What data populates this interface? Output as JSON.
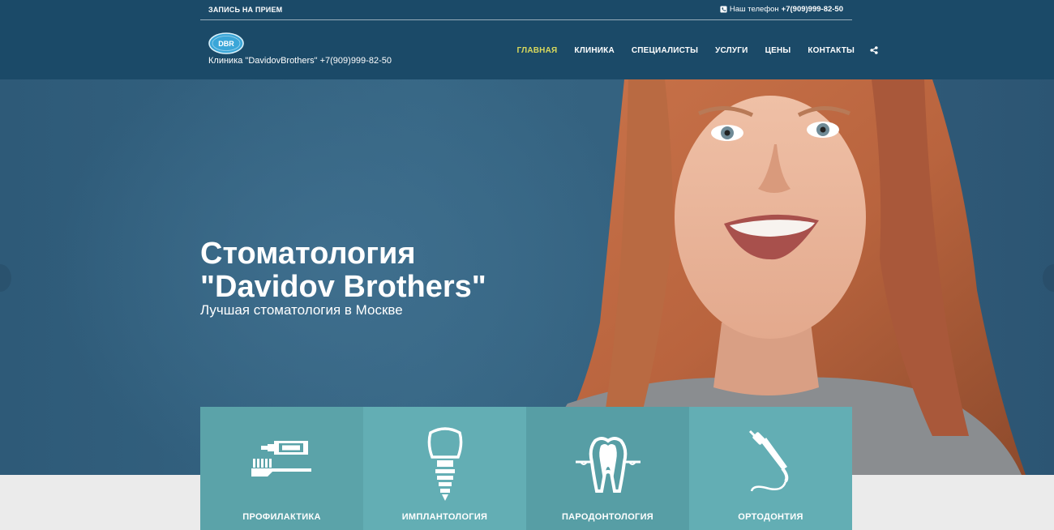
{
  "topbar": {
    "appointment_label": "ЗАПИСЬ НА ПРИЕМ",
    "phone_label": "Наш телефон",
    "phone_number": "+7(909)999-82-50"
  },
  "brand": {
    "logo_text": "DBR",
    "caption": "Клиника \"DavidovBrothers\" +7(909)999-82-50"
  },
  "nav": {
    "items": [
      {
        "label": "ГЛАВНАЯ",
        "active": true
      },
      {
        "label": "КЛИНИКА"
      },
      {
        "label": "СПЕЦИАЛИСТЫ"
      },
      {
        "label": "УСЛУГИ"
      },
      {
        "label": "ЦЕНЫ"
      },
      {
        "label": "КОНТАКТЫ"
      }
    ]
  },
  "hero": {
    "title_line1": "Стоматология",
    "title_line2": "\"Davidov Brothers\"",
    "subtitle": "Лучшая стоматология в Москве"
  },
  "services": [
    {
      "label": "ПРОФИЛАКТИКА",
      "icon": "toothbrush-icon",
      "color": "#5ba3a9"
    },
    {
      "label": "ИМПЛАНТОЛОГИЯ",
      "icon": "implant-icon",
      "color": "#63aeb4"
    },
    {
      "label": "ПАРОДОНТОЛОГИЯ",
      "icon": "tooth-gum-icon",
      "color": "#579ea5"
    },
    {
      "label": "ОРТОДОНТИЯ",
      "icon": "dental-drill-icon",
      "color": "#63aeb4"
    }
  ],
  "colors": {
    "header_bg": "#1b4a68",
    "nav_active": "#d8d85c",
    "hero_bg": "#336382"
  }
}
